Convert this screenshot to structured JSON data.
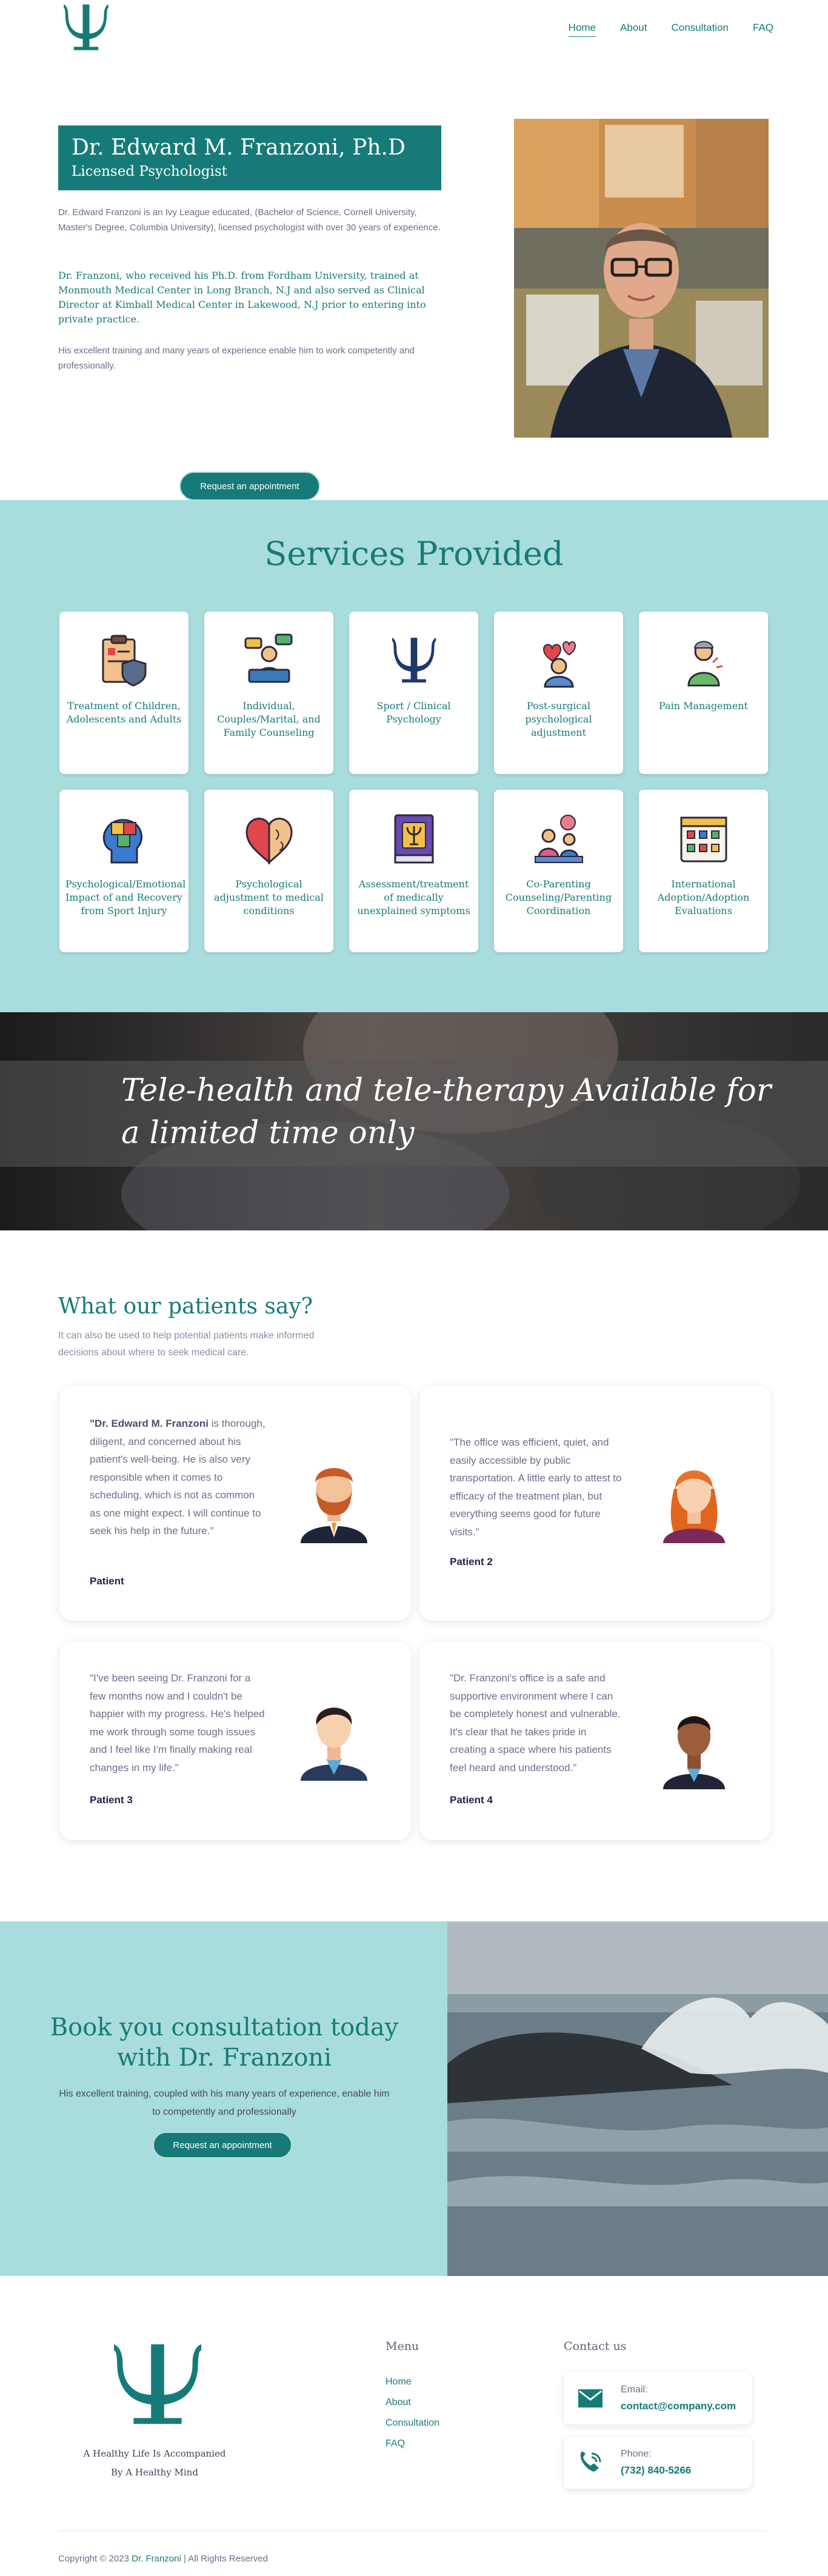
{
  "nav": {
    "items": [
      {
        "label": "Home",
        "active": true
      },
      {
        "label": "About",
        "active": false
      },
      {
        "label": "Consultation",
        "active": false
      },
      {
        "label": "FAQ",
        "active": false
      }
    ]
  },
  "hero": {
    "title": "Dr. Edward M. Franzoni, Ph.D",
    "subtitle": "Licensed Psychologist",
    "p1": "Dr. Edward Franzoni is an Ivy League educated, (Bachelor of Science, Cornell University, Master's Degree, Columbia University), licensed psychologist with over 30 years of experience.",
    "p2": "Dr. Franzoni, who received his Ph.D. from Fordham University, trained at Monmouth Medical Center in Long Branch, N.J and also served as Clinical Director at Kimball Medical Center in Lakewood, N.J prior to entering into private practice.",
    "p3": "His excellent training and many years of experience enable him to work competently and professionally.",
    "button": "Request an appointment"
  },
  "services": {
    "title": "Services Provided",
    "items": [
      {
        "label": "Treatment of Children, Adolescents and Adults",
        "icon": "clipboard-shield-icon"
      },
      {
        "label": "Individual, Couples/Marital, and Family Counseling",
        "icon": "counseling-icon"
      },
      {
        "label": "Sport / Clinical Psychology",
        "icon": "psi-icon"
      },
      {
        "label": "Post-surgical psychological adjustment",
        "icon": "patient-hearts-icon"
      },
      {
        "label": "Pain Management",
        "icon": "pain-person-icon"
      },
      {
        "label": "Psychological/Emotional Impact of and Recovery from Sport Injury",
        "icon": "puzzle-head-icon"
      },
      {
        "label": "Psychological adjustment to medical conditions",
        "icon": "heart-brain-icon"
      },
      {
        "label": "Assessment/treatment of medically unexplained symptoms",
        "icon": "psi-book-icon"
      },
      {
        "label": "Co-Parenting Counseling/Parenting Coordination",
        "icon": "therapy-session-icon"
      },
      {
        "label": "International Adoption/Adoption Evaluations",
        "icon": "checklist-icon"
      }
    ]
  },
  "banner": {
    "text": "Tele-health and tele-therapy Available for a limited time only"
  },
  "testimonials": {
    "title": "What our patients say?",
    "subtitle": "It can also be used to help potential patients make informed decisions about where to seek medical care.",
    "items": [
      {
        "lead": "\"Dr. Edward M. Franzoni",
        "quote": " is thorough, diligent, and concerned about his patient's well-being. He is also very responsible when it comes to scheduling, which is not as common as one might expect. I will continue to seek his help in the future.\"",
        "name": "Patient"
      },
      {
        "lead": "",
        "quote": "\"The office was efficient, quiet, and easily accessible by public transportation. A little early to attest to efficacy of the treatment plan, but everything seems good for future visits.\"",
        "name": "Patient 2"
      },
      {
        "lead": "",
        "quote": "\"I've been seeing Dr. Franzoni for a few months now and I couldn't be happier with my progress. He's helped me work through some tough issues and I feel like I'm finally making real changes in my life.\"",
        "name": "Patient 3"
      },
      {
        "lead": "",
        "quote": "\"Dr. Franzoni's office is a safe and supportive environment where I can be completely honest and vulnerable. It's clear that he takes pride in creating a space where his patients feel heard and understood.\"",
        "name": "Patient 4"
      }
    ]
  },
  "cta": {
    "title": "Book you consultation today with Dr. Franzoni",
    "text": "His excellent training, coupled with his many years of experience, enable him to competently and professionally",
    "button": "Request an appointment"
  },
  "footer": {
    "tagline_1": "A Healthy Life Is Accompanied",
    "tagline_2": "By A Healthy Mind",
    "menu_title": "Menu",
    "menu": [
      "Home",
      "About",
      "Consultation",
      "FAQ"
    ],
    "contact_title": "Contact us",
    "email_label": "Email:",
    "email": "contact@company.com",
    "phone_label": "Phone:",
    "phone": "(732) 840-5266",
    "copyright_pre": "Copyright © 2023 ",
    "copyright_name": "Dr. Franzoni",
    "copyright_post": " | All Rights Reserved"
  },
  "colors": {
    "accent": "#167b78",
    "section_bg": "#a9dcdc"
  }
}
